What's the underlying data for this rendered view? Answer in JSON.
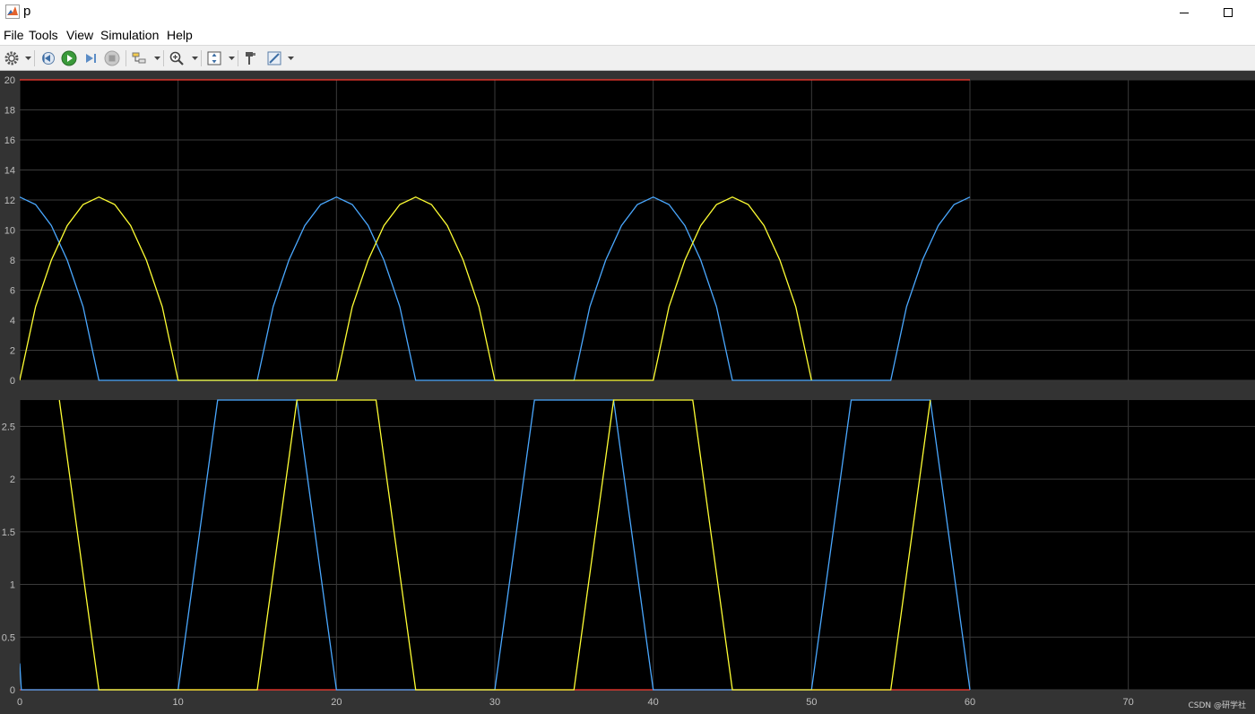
{
  "window": {
    "title": "p"
  },
  "menu": [
    "File",
    "Tools",
    "View",
    "Simulation",
    "Help"
  ],
  "toolbar": {
    "icons": [
      "settings-icon",
      "step-back-icon",
      "run-icon",
      "step-forward-icon",
      "stop-icon",
      "highlight-icon",
      "zoom-icon",
      "fit-axes-icon",
      "style-icon",
      "measure-icon"
    ]
  },
  "colors": {
    "plot_bg": "#000000",
    "frame_bg": "#333333",
    "grid": "#3a3a3a",
    "series_blue": "#4aa8ff",
    "series_yellow": "#ffff33",
    "series_red": "#ff3b30",
    "series_cyan": "#55ffcc"
  },
  "chart_data": [
    {
      "type": "line",
      "title": "",
      "xlabel": "",
      "ylabel": "",
      "xlim": [
        0,
        78
      ],
      "ylim": [
        0,
        20
      ],
      "yticks": [
        "0",
        "2",
        "4",
        "6",
        "8",
        "10",
        "12",
        "14",
        "16",
        "18",
        "20"
      ],
      "grid": true,
      "series": [
        {
          "color": "#ff3b30",
          "x": [
            0,
            60
          ],
          "y": [
            20,
            20
          ]
        },
        {
          "color": "#4aa8ff",
          "x": [
            0,
            1,
            2,
            3,
            4,
            5,
            15,
            16,
            17,
            18,
            19,
            20,
            21,
            22,
            23,
            24,
            25,
            35,
            36,
            37,
            38,
            39,
            40,
            41,
            42,
            43,
            44,
            45,
            55,
            56,
            57,
            58,
            59,
            60
          ],
          "y": [
            12.2,
            11.7,
            10.3,
            8.0,
            4.9,
            0,
            0,
            4.9,
            8.0,
            10.3,
            11.7,
            12.2,
            11.7,
            10.3,
            8.0,
            4.9,
            0,
            0,
            4.9,
            8.0,
            10.3,
            11.7,
            12.2,
            11.7,
            10.3,
            8.0,
            4.9,
            0,
            0,
            4.9,
            8.0,
            10.3,
            11.7,
            12.2
          ]
        },
        {
          "color": "#ffff33",
          "x": [
            0,
            1,
            2,
            3,
            4,
            5,
            6,
            7,
            8,
            9,
            10,
            20,
            21,
            22,
            23,
            24,
            25,
            26,
            27,
            28,
            29,
            30,
            40,
            41,
            42,
            43,
            44,
            45,
            46,
            47,
            48,
            49,
            50
          ],
          "y": [
            0,
            4.9,
            8.0,
            10.3,
            11.7,
            12.2,
            11.7,
            10.3,
            8.0,
            4.9,
            0,
            0,
            4.9,
            8.0,
            10.3,
            11.7,
            12.2,
            11.7,
            10.3,
            8.0,
            4.9,
            0,
            0,
            4.9,
            8.0,
            10.3,
            11.7,
            12.2,
            11.7,
            10.3,
            8.0,
            4.9,
            0
          ]
        }
      ]
    },
    {
      "type": "line",
      "title": "",
      "xlabel": "",
      "ylabel": "",
      "xlim": [
        0,
        78
      ],
      "ylim": [
        0,
        2.75
      ],
      "xticks": [
        "0",
        "10",
        "20",
        "30",
        "40",
        "50",
        "60",
        "70"
      ],
      "yticks": [
        "0",
        "0.5",
        "1",
        "1.5",
        "2",
        "2.5"
      ],
      "grid": true,
      "series": [
        {
          "color": "#ff3b30",
          "x": [
            0,
            60
          ],
          "y": [
            0,
            0
          ]
        },
        {
          "color": "#4aa8ff",
          "x": [
            0,
            0.1,
            10,
            12.5,
            17.5,
            20,
            30,
            32.5,
            37.5,
            40,
            50,
            52.5,
            57.5,
            60
          ],
          "y": [
            0.25,
            0,
            0,
            2.75,
            2.75,
            0,
            0,
            2.75,
            2.75,
            0,
            0,
            2.75,
            2.75,
            0
          ]
        },
        {
          "color": "#ffff33",
          "x": [
            2.5,
            5,
            15,
            17.5,
            22.5,
            25,
            35,
            37.5,
            42.5,
            45,
            55,
            57.5
          ],
          "y": [
            2.75,
            0,
            0,
            2.75,
            2.75,
            0,
            0,
            2.75,
            2.75,
            0,
            0,
            2.75
          ]
        }
      ]
    }
  ],
  "watermark": "CSDN @研学社"
}
